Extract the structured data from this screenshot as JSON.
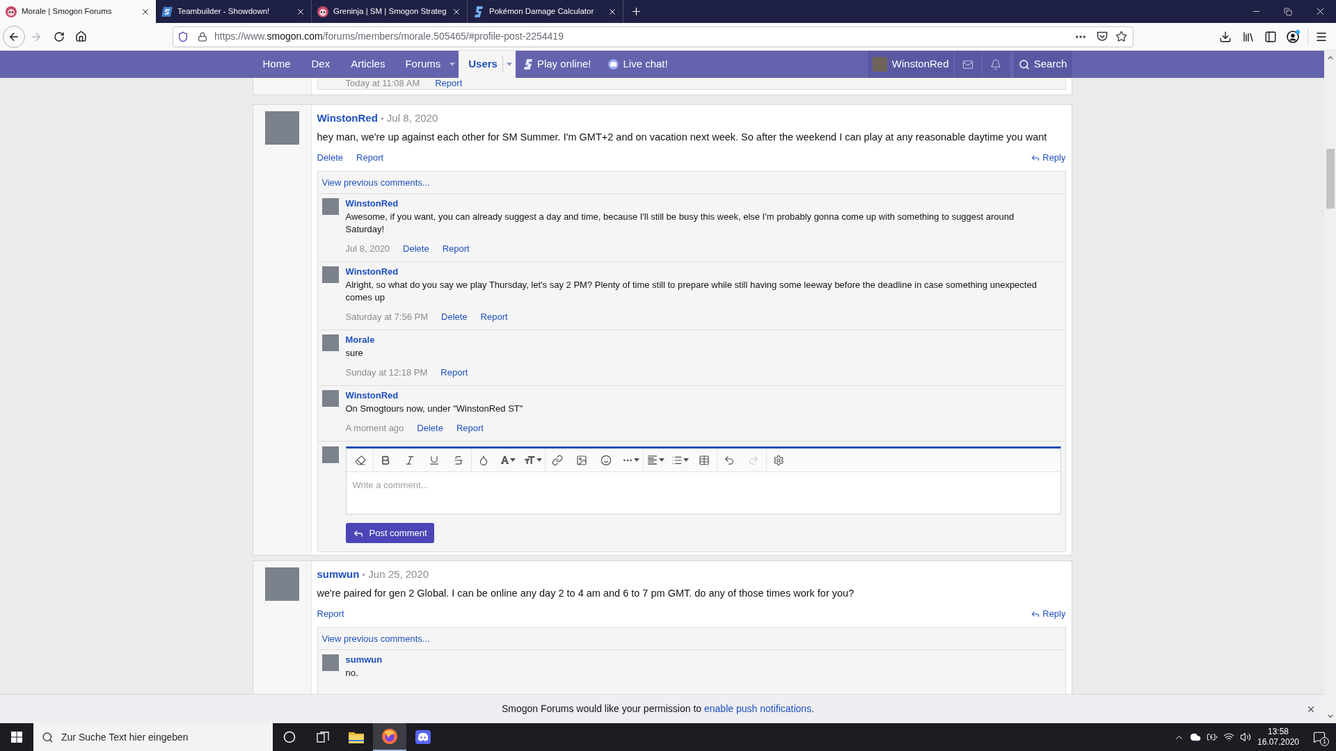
{
  "browser": {
    "tabs": [
      {
        "title": "Morale | Smogon Forums",
        "kind": "forum",
        "selected": true
      },
      {
        "title": "Teambuilder - Showdown!",
        "kind": "builder",
        "selected": false
      },
      {
        "title": "Greninja | SM | Smogon Strateg",
        "kind": "forum",
        "selected": false
      },
      {
        "title": "Pokémon Damage Calculator",
        "kind": "calc",
        "selected": false
      }
    ],
    "forward_disabled": true,
    "url": {
      "prefix": "https://www.",
      "domain": "smogon.com",
      "path": "/forums/members/morale.505465/#profile-post-2254419"
    }
  },
  "nav": {
    "items": [
      {
        "label": "Home",
        "kind": "link",
        "selected": false
      },
      {
        "label": "Dex",
        "kind": "link",
        "selected": false
      },
      {
        "label": "Articles",
        "kind": "link",
        "selected": false
      },
      {
        "label": "Forums",
        "kind": "menu",
        "selected": false
      },
      {
        "label": "Users",
        "kind": "menu",
        "selected": true
      },
      {
        "label": "Play online!",
        "kind": "play",
        "selected": false
      },
      {
        "label": "Live chat!",
        "kind": "chat",
        "selected": false
      }
    ],
    "user": "WinstonRed",
    "search": "Search"
  },
  "previous_comment": {
    "time": "Today at 11:08 AM",
    "actions": [
      "Report"
    ]
  },
  "posts": [
    {
      "author": "WinstonRed",
      "date": "Jul 8, 2020",
      "text": "hey man, we're up against each other for SM Summer. I'm GMT+2 and on vacation next week. So after the weekend I can play at any reasonable daytime you want",
      "actions": [
        "Delete",
        "Report"
      ],
      "reply": "Reply",
      "more": "View previous comments...",
      "comments": [
        {
          "author": "WinstonRed",
          "text": "Awesome, if you want, you can already suggest a day and time, because I'll still be busy this week, else I'm probably gonna come up with something to suggest around Saturday!",
          "time": "Jul 8, 2020",
          "actions": [
            "Delete",
            "Report"
          ]
        },
        {
          "author": "WinstonRed",
          "text": "Alright, so what do you say we play Thursday, let's say 2 PM? Plenty of time still to prepare while still having some leeway before the deadline in case something unexpected comes up",
          "time": "Saturday at 7:56 PM",
          "actions": [
            "Delete",
            "Report"
          ]
        },
        {
          "author": "Morale",
          "text": "sure",
          "time": "Sunday at 12:18 PM",
          "actions": [
            "Report"
          ]
        },
        {
          "author": "WinstonRed",
          "text": "On Smogtours now, under \"WinstonRed ST\"",
          "time": "A moment ago",
          "actions": [
            "Delete",
            "Report"
          ]
        }
      ],
      "editor": {
        "placeholder": "Write a comment...",
        "submit": "Post comment",
        "redo_disabled": true
      }
    },
    {
      "author": "sumwun",
      "date": "Jun 25, 2020",
      "text": "we're paired for gen 2 Global. I can be online any day 2 to 4 am and 6 to 7 pm GMT. do any of those times work for you?",
      "actions": [
        "Report"
      ],
      "reply": "Reply",
      "more": "View previous comments...",
      "comments": [
        {
          "author": "sumwun",
          "text": "no."
        }
      ]
    }
  ],
  "notice": {
    "before": "Smogon Forums would like your permission to",
    "link": "enable push notifications",
    "after": "."
  },
  "taskbar": {
    "search_placeholder": "Zur Suche Text hier eingeben",
    "apps": [
      {
        "kind": "cortana",
        "selected": false
      },
      {
        "kind": "taskview",
        "selected": false
      },
      {
        "kind": "explorer",
        "selected": false
      },
      {
        "kind": "firefox",
        "selected": true
      },
      {
        "kind": "discord",
        "selected": false
      }
    ],
    "time": "13:58",
    "date": "16.07.2020",
    "notifications": "1"
  }
}
